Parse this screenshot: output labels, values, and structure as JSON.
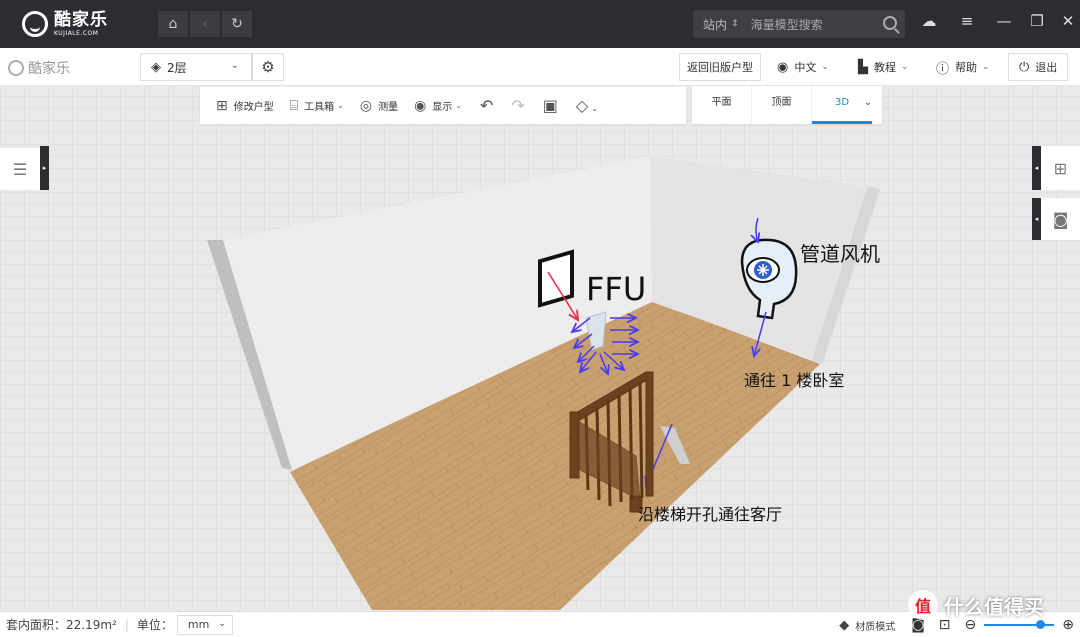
{
  "app": {
    "logo_cn": "酷家乐",
    "logo_en": "KUJIALE.COM"
  },
  "titlebar": {
    "nav_icons": [
      "home-icon",
      "back-icon",
      "refresh-icon"
    ],
    "search_scope": "站内",
    "search_placeholder": "海量模型搜索",
    "window_icons": [
      "cloud-upload-icon",
      "menu-icon",
      "minimize-icon",
      "maximize-icon",
      "close-icon"
    ]
  },
  "toolbar": {
    "brand": "酷家乐",
    "floor": "2层",
    "old_version": "返回旧版户型",
    "language": "中文",
    "tutorial": "教程",
    "help": "帮助",
    "logout": "退出"
  },
  "tools": {
    "edit_floorplan": "修改户型",
    "toolbox": "工具箱",
    "measure": "测量",
    "display": "显示"
  },
  "view_tabs": {
    "items": [
      "平面",
      "顶面",
      "3D"
    ],
    "active": "3D"
  },
  "annotations": {
    "ffu": "FFU",
    "duct_fan": "管道风机",
    "to_bedroom": "通往 1 楼卧室",
    "to_living": "沿楼梯开孔通往客厅"
  },
  "status": {
    "area": "套内面积：22.19m²",
    "unit_label": "单位：",
    "unit_value": "mm",
    "material_mode": "材质模式"
  },
  "watermark": {
    "badge": "值",
    "text": "什么值得买"
  },
  "colors": {
    "titlebar_bg": "#2b2d31",
    "accent": "#1e88e5",
    "floor": "#c49a6c",
    "arrow_blue": "#4a3cf0",
    "arrow_red": "#e8304a"
  }
}
